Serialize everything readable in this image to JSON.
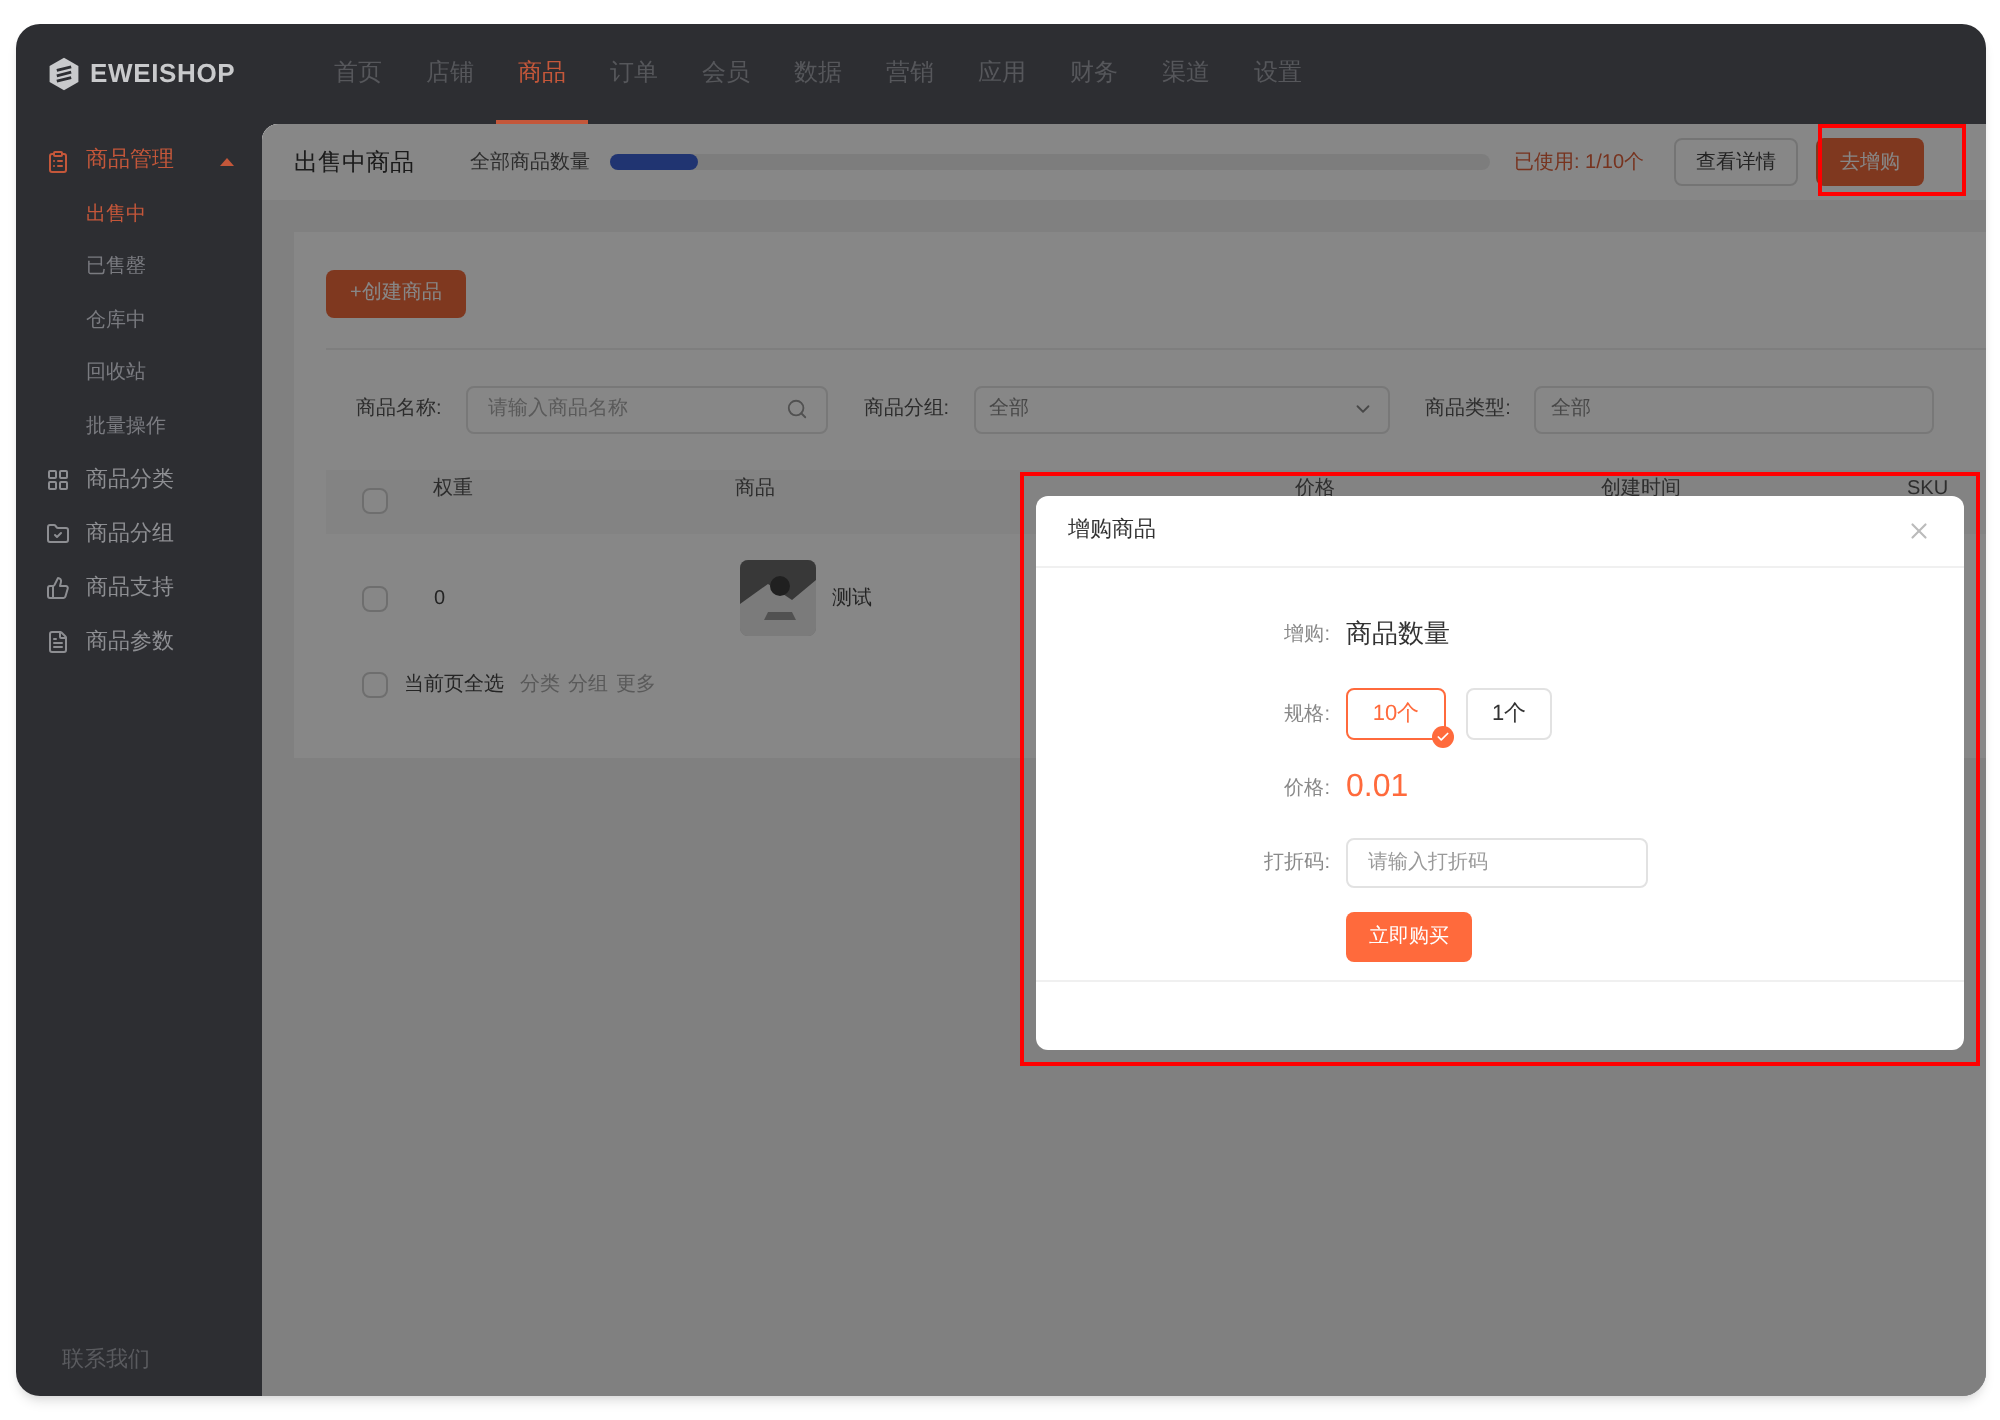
{
  "brand": "EWEISHOP",
  "nav": [
    {
      "label": "首页",
      "selected": false
    },
    {
      "label": "店铺",
      "selected": false
    },
    {
      "label": "商品",
      "selected": true
    },
    {
      "label": "订单",
      "selected": false
    },
    {
      "label": "会员",
      "selected": false
    },
    {
      "label": "数据",
      "selected": false
    },
    {
      "label": "营销",
      "selected": false
    },
    {
      "label": "应用",
      "selected": false
    },
    {
      "label": "财务",
      "selected": false
    },
    {
      "label": "渠道",
      "selected": false
    },
    {
      "label": "设置",
      "selected": false
    }
  ],
  "sidebar": {
    "items": [
      {
        "label": "商品管理",
        "expanded": true,
        "selected": true,
        "children": [
          {
            "label": "出售中",
            "selected": true
          },
          {
            "label": "已售罄",
            "selected": false
          },
          {
            "label": "仓库中",
            "selected": false
          },
          {
            "label": "回收站",
            "selected": false
          },
          {
            "label": "批量操作",
            "selected": false
          }
        ]
      },
      {
        "label": "商品分类",
        "expanded": false,
        "selected": false
      },
      {
        "label": "商品分组",
        "expanded": false,
        "selected": false
      },
      {
        "label": "商品支持",
        "expanded": false,
        "selected": false
      },
      {
        "label": "商品参数",
        "expanded": false,
        "selected": false
      }
    ],
    "footer": "联系我们"
  },
  "page": {
    "title": "出售中商品",
    "quota_label": "全部商品数量",
    "quota": {
      "level": 0.1
    },
    "used": "已使用: 1/10个",
    "details_button": "查看详情",
    "buy_button": "去增购"
  },
  "create_button": "+创建商品",
  "filters": [
    {
      "label": "商品名称:",
      "kind": "search",
      "placeholder": "请输入商品名称"
    },
    {
      "label": "商品分组:",
      "kind": "select",
      "value": "全部"
    },
    {
      "label": "商品类型:",
      "kind": "select_cut",
      "value": "全部"
    }
  ],
  "table": {
    "header_checked": false,
    "columns": [
      "权重",
      "商品",
      "价格",
      "创建时间",
      "SKU"
    ],
    "rows": [
      {
        "checked": false,
        "weight": "0",
        "name": "测试"
      }
    ],
    "footer": {
      "checked": false,
      "label": "当前页全选",
      "actions": [
        "分类",
        "分组",
        "更多"
      ]
    }
  },
  "dialog": {
    "title": "增购商品",
    "item_label": "增购:",
    "item": "商品数量",
    "spec_label": "规格:",
    "specs": [
      {
        "label": "10个",
        "selected": true
      },
      {
        "label": "1个",
        "selected": false
      }
    ],
    "price_label": "价格:",
    "price": "0.01",
    "code_label": "打折码:",
    "code_placeholder": "请输入打折码",
    "submit": "立即购买"
  }
}
